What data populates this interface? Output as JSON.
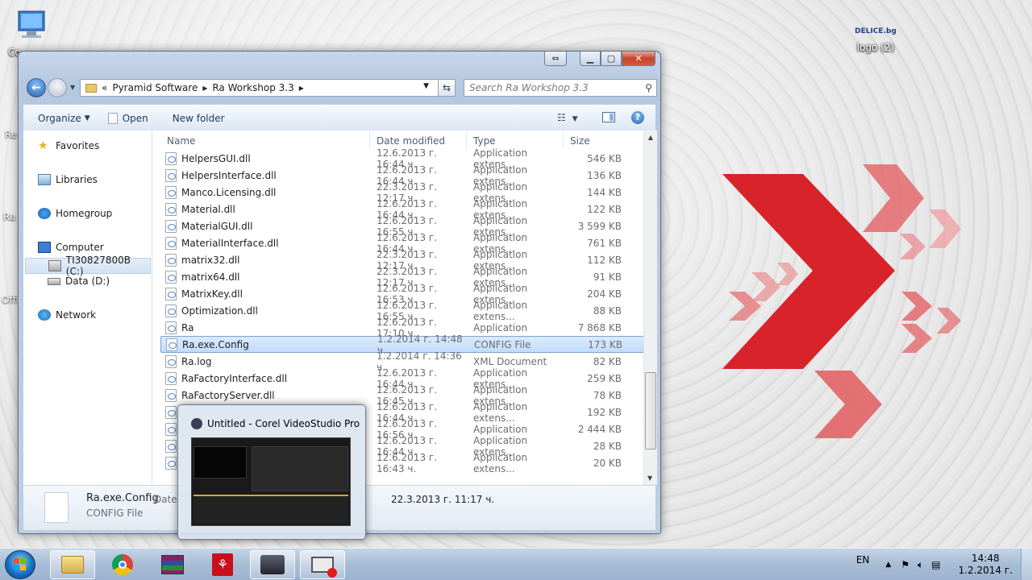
{
  "desktop": {
    "icons": [
      {
        "label": "Co",
        "icon": "computer-icon"
      },
      {
        "label": "logo (2)",
        "icon": "image-file-icon",
        "logo_text": "DELICE.bg"
      }
    ],
    "edge_labels": [
      "Re",
      "Ra",
      "Offi"
    ]
  },
  "explorer": {
    "breadcrumb": [
      "Pyramid Software",
      "Ra Workshop 3.3"
    ],
    "search_placeholder": "Search Ra Workshop 3.3",
    "toolbar": {
      "organize": "Organize",
      "open": "Open",
      "new_folder": "New folder"
    },
    "nav": {
      "favorites": "Favorites",
      "libraries": "Libraries",
      "homegroup": "Homegroup",
      "computer": "Computer",
      "drive_c": "TI30827800B (C:)",
      "drive_d": "Data (D:)",
      "network": "Network"
    },
    "columns": {
      "name": "Name",
      "date": "Date modified",
      "type": "Type",
      "size": "Size"
    },
    "files": [
      {
        "name": "HelpersGUI.dll",
        "date": "12.6.2013 г. 16:44 ч.",
        "type": "Application extens...",
        "size": "546 KB"
      },
      {
        "name": "HelpersInterface.dll",
        "date": "12.6.2013 г. 16:44 ч.",
        "type": "Application extens...",
        "size": "136 KB"
      },
      {
        "name": "Manco.Licensing.dll",
        "date": "22.3.2013 г. 12:17 ч.",
        "type": "Application extens...",
        "size": "144 KB"
      },
      {
        "name": "Material.dll",
        "date": "12.6.2013 г. 16:44 ч.",
        "type": "Application extens...",
        "size": "122 KB"
      },
      {
        "name": "MaterialGUI.dll",
        "date": "12.6.2013 г. 16:55 ч.",
        "type": "Application extens...",
        "size": "3 599 KB"
      },
      {
        "name": "MaterialInterface.dll",
        "date": "12.6.2013 г. 16:44 ч.",
        "type": "Application extens...",
        "size": "761 KB"
      },
      {
        "name": "matrix32.dll",
        "date": "22.3.2013 г. 12:17 ч.",
        "type": "Application extens...",
        "size": "112 KB"
      },
      {
        "name": "matrix64.dll",
        "date": "22.3.2013 г. 12:17 ч.",
        "type": "Application extens...",
        "size": "91 KB"
      },
      {
        "name": "MatrixKey.dll",
        "date": "12.6.2013 г. 16:53 ч.",
        "type": "Application extens...",
        "size": "204 KB"
      },
      {
        "name": "Optimization.dll",
        "date": "12.6.2013 г. 16:55 ч.",
        "type": "Application extens...",
        "size": "88 KB"
      },
      {
        "name": "Ra",
        "date": "12.6.2013 г. 17:10 ч.",
        "type": "Application",
        "size": "7 868 KB"
      },
      {
        "name": "Ra.exe.Config",
        "date": "1.2.2014 г. 14:48 ч.",
        "type": "CONFIG File",
        "size": "173 KB"
      },
      {
        "name": "Ra.log",
        "date": "1.2.2014 г. 14:36 ч.",
        "type": "XML Document",
        "size": "82 KB"
      },
      {
        "name": "RaFactoryInterface.dll",
        "date": "12.6.2013 г. 16:44 ч.",
        "type": "Application extens...",
        "size": "259 KB"
      },
      {
        "name": "RaFactoryServer.dll",
        "date": "12.6.2013 г. 16:45 ч.",
        "type": "Application extens...",
        "size": "78 KB"
      },
      {
        "name": "",
        "date": "12.6.2013 г. 16:44 ч.",
        "type": "Application extens...",
        "size": "192 KB"
      },
      {
        "name": "",
        "date": "12.6.2013 г. 16:56 ч.",
        "type": "Application",
        "size": "2 444 KB"
      },
      {
        "name": "",
        "date": "12.6.2013 г. 16:44 ч.",
        "type": "Application extens...",
        "size": "28 KB"
      },
      {
        "name": "",
        "date": "12.6.2013 г. 16:43 ч.",
        "type": "Application extens...",
        "size": "20 KB"
      }
    ],
    "selected_index": 11,
    "details": {
      "name": "Ra.exe.Config",
      "type": "CONFIG File",
      "date_label": "Date",
      "date_value": "22.3.2013 г. 11:17 ч."
    }
  },
  "thumbnail": {
    "title": "Untitled - Corel VideoStudio Pro"
  },
  "taskbar": {
    "language": "EN",
    "time": "14:48",
    "date": "1.2.2014 г.",
    "apps": [
      "explorer-icon",
      "chrome-icon",
      "winrar-icon",
      "acrobat-icon",
      "videostudio-icon",
      "screen-recorder-icon"
    ]
  },
  "colors": {
    "accent_red": "#d8232a",
    "selection": "#c1dcfc"
  }
}
